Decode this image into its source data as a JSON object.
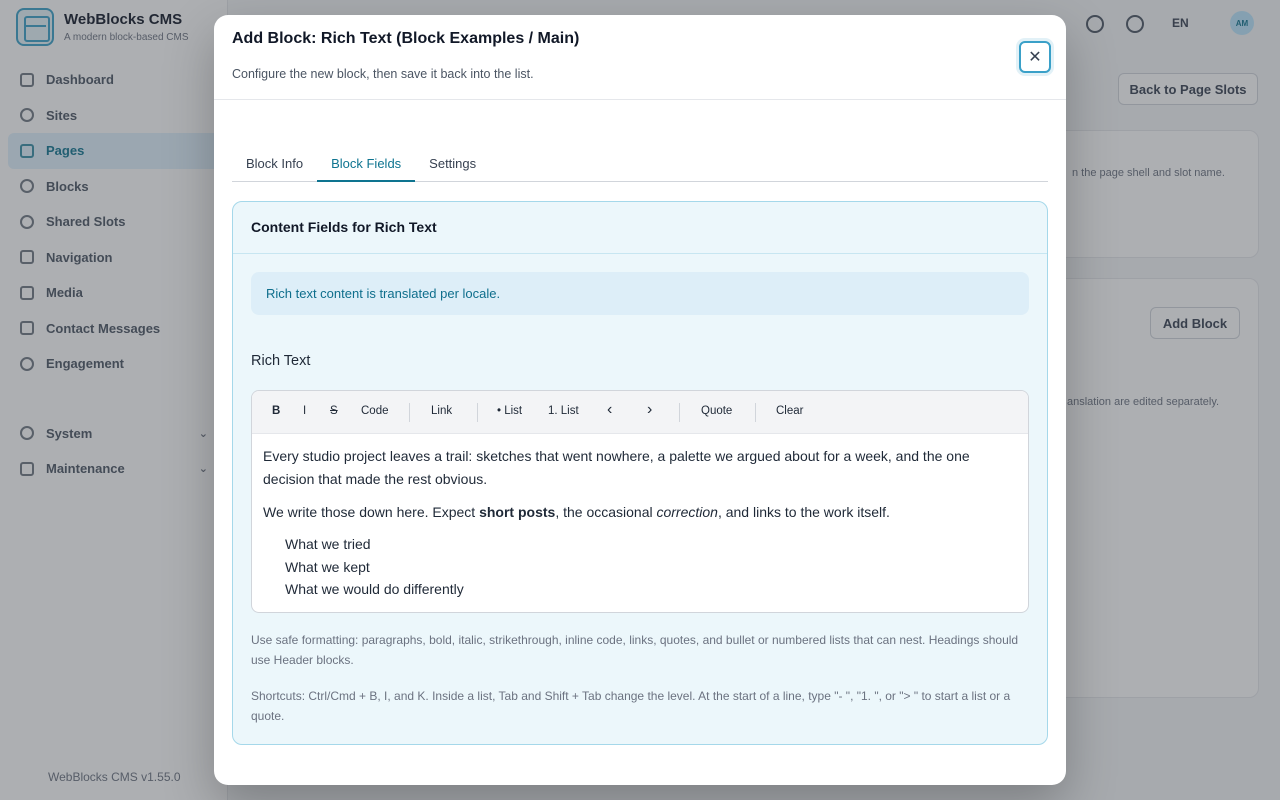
{
  "app": {
    "brand_name": "WebBlocks CMS",
    "brand_tagline": "A modern block-based CMS",
    "version": "WebBlocks CMS v1.55.0",
    "locale": "EN",
    "avatar_initials": "AM",
    "nav": [
      {
        "label": "Dashboard",
        "icon": "dashboard-icon"
      },
      {
        "label": "Sites",
        "icon": "globe-icon"
      },
      {
        "label": "Pages",
        "icon": "page-icon",
        "active": true
      },
      {
        "label": "Blocks",
        "icon": "blocks-icon"
      },
      {
        "label": "Shared Slots",
        "icon": "stack-icon"
      },
      {
        "label": "Navigation",
        "icon": "menu-icon"
      },
      {
        "label": "Media",
        "icon": "image-icon"
      },
      {
        "label": "Contact Messages",
        "icon": "mail-icon"
      },
      {
        "label": "Engagement",
        "icon": "star-icon"
      }
    ],
    "nav_groups": [
      {
        "label": "System",
        "icon": "gear-icon"
      },
      {
        "label": "Maintenance",
        "icon": "wrench-icon"
      }
    ],
    "back_button": "Back to Page Slots",
    "add_block_button": "Add Block",
    "note_1": "n the page shell and slot name.",
    "note_2": "anslation are edited separately."
  },
  "modal": {
    "title": "Add Block: Rich Text (Block Examples / Main)",
    "subtitle": "Configure the new block, then save it back into the list.",
    "close_label": "✕",
    "tabs": [
      {
        "label": "Block Info"
      },
      {
        "label": "Block Fields",
        "active": true
      },
      {
        "label": "Settings"
      }
    ],
    "panel_title": "Content Fields for Rich Text",
    "info_text": "Rich text content is translated per locale.",
    "field_label": "Rich Text",
    "toolbar": {
      "bold": "B",
      "italic": "I",
      "strike": "S",
      "code": "Code",
      "link": "Link",
      "bullet_list": "• List",
      "numbered_list": "1. List",
      "outdent": "‹",
      "indent": "›",
      "quote": "Quote",
      "clear": "Clear"
    },
    "content": {
      "p1": "Every studio project leaves a trail: sketches that went nowhere, a palette we argued about for a week, and the one decision that made the rest obvious.",
      "p2_a": "We write those down here. Expect ",
      "p2_bold": "short posts",
      "p2_b": ", the occasional ",
      "p2_italic": "correction",
      "p2_c": ", and links to the work itself.",
      "list": [
        "What we tried",
        "What we kept",
        "What we would do differently"
      ]
    },
    "help_1": "Use safe formatting: paragraphs, bold, italic, strikethrough, inline code, links, quotes, and bullet or numbered lists that can nest. Headings should use Header blocks.",
    "help_2": "Shortcuts: Ctrl/Cmd + B, I, and K. Inside a list, Tab and Shift + Tab change the level. At the start of a line, type \"- \", \"1. \", or \"> \" to start a list or a quote."
  }
}
